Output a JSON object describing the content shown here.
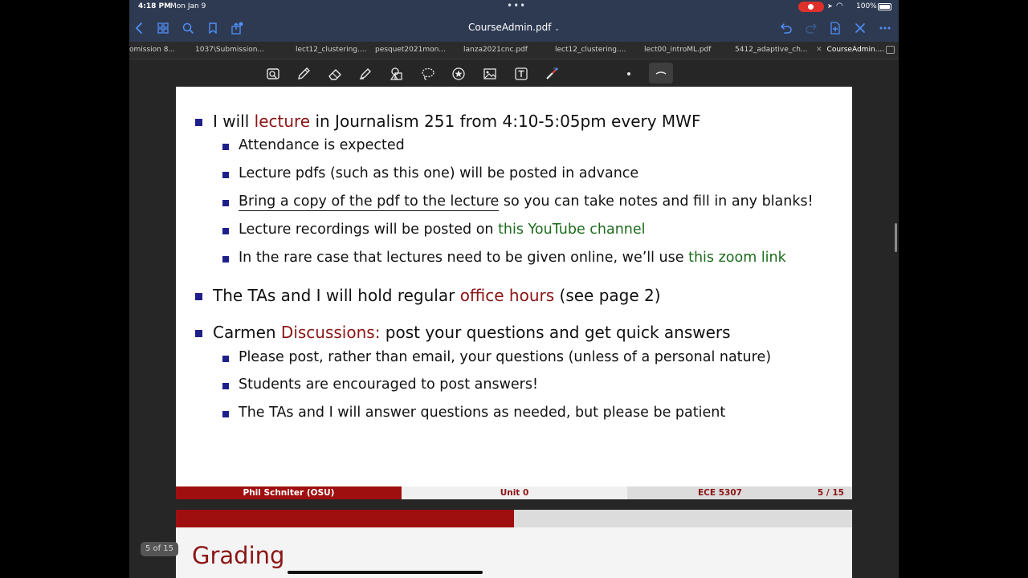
{
  "status_bar": {
    "time": "4:18 PM",
    "date": "Mon Jan 9",
    "battery": "100%"
  },
  "title_bar": {
    "title": "CourseAdmin.pdf",
    "chevron": "⌄"
  },
  "tabs": [
    {
      "label": "omission 8..."
    },
    {
      "label": "1037\\Submission..."
    },
    {
      "label": "lect12_clustering...."
    },
    {
      "label": "pesquet2021mon..."
    },
    {
      "label": "lanza2021cnc.pdf"
    },
    {
      "label": "lect12_clustering...."
    },
    {
      "label": "lect00_introML.pdf"
    },
    {
      "label": "5412_adaptive_ch..."
    },
    {
      "label": "CourseAdmin...."
    }
  ],
  "toolbar": {
    "tools": [
      "lasso-select-icon",
      "pen-icon",
      "eraser-icon",
      "highlighter-icon",
      "shapes-icon",
      "lasso-icon",
      "sticker-icon",
      "image-icon",
      "text-icon",
      "laser-pointer-icon",
      "dot-size-icon",
      "stroke-style-icon"
    ]
  },
  "slide": {
    "b1": {
      "pre": "I will ",
      "hl": "lecture",
      "post": " in Journalism 251 from 4:10-5:05pm every MWF"
    },
    "b1a": "Attendance is expected",
    "b1b": "Lecture pdfs (such as this one) will be posted in advance",
    "b1c": {
      "ul": "Bring a copy of the pdf to the lecture",
      "post": " so you can take notes and fill in any blanks!"
    },
    "b1d": {
      "pre": "Lecture recordings will be posted on ",
      "link": "this YouTube channel"
    },
    "b1e": {
      "pre": "In the rare case that lectures need to be given online, we’ll use ",
      "link": "this zoom link"
    },
    "b2": {
      "pre": "The TAs and I will hold regular ",
      "hl": "office hours",
      "post": " (see page 2)"
    },
    "b3": {
      "pre": "Carmen ",
      "hl": "Discussions:",
      "post": " post your questions and get quick answers"
    },
    "b3a": "Please post, rather than email, your questions (unless of a personal nature)",
    "b3b": "Students are encouraged to post answers!",
    "b3c": "The TAs and I will answer questions as needed, but please be patient"
  },
  "footer": {
    "author": "Phil Schniter  (OSU)",
    "unit": "Unit 0",
    "course": "ECE 5307",
    "page": "5 / 15"
  },
  "next_page": {
    "heading": "Grading"
  },
  "page_indicator": "5 of 15",
  "colors": {
    "accent": "#4f8ff7",
    "beamer_red": "#8b1515",
    "link_green": "#1b6a1b",
    "bullet_blue": "#1f1f8c"
  }
}
